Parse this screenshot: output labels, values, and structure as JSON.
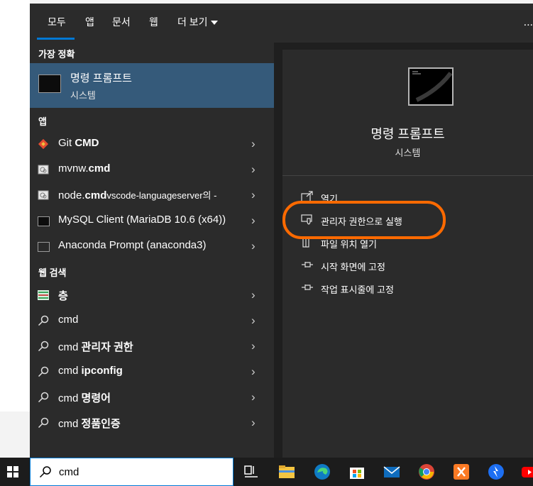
{
  "tabs": {
    "all": "모두",
    "apps": "앱",
    "documents": "문서",
    "web": "웹",
    "more": "더 보기",
    "dots": "..."
  },
  "best_match": {
    "header": "가장 정확",
    "title": "명령 프롬프트",
    "subtitle": "시스템"
  },
  "apps_section": {
    "header": "앱",
    "items": [
      {
        "pre": "Git ",
        "bold": "CMD",
        "post": ""
      },
      {
        "pre": "mvnw.",
        "bold": "cmd",
        "post": ""
      },
      {
        "pre": "node.",
        "bold": "cmd",
        "post": "vscode-languageserver의 -"
      },
      {
        "label": "MySQL Client (MariaDB 10.6 (x64))"
      },
      {
        "label": "Anaconda Prompt (anaconda3)"
      }
    ]
  },
  "web_section": {
    "header": "웹 검색",
    "items": [
      {
        "pre": "",
        "bold": "층",
        "post": ""
      },
      {
        "pre": "cmd",
        "bold": "",
        "post": ""
      },
      {
        "pre": "cmd ",
        "bold": "관리자 권한",
        "post": ""
      },
      {
        "pre": "cmd ",
        "bold": "ipconfig",
        "post": ""
      },
      {
        "pre": "cmd ",
        "bold": "명령어",
        "post": ""
      },
      {
        "pre": "cmd ",
        "bold": "정품인증",
        "post": ""
      }
    ]
  },
  "preview": {
    "title": "명령 프롬프트",
    "subtitle": "시스템",
    "actions": {
      "open": "열기",
      "run_as_admin": "관리자 권한으로 실행",
      "open_location": "파일 위치 열기",
      "pin_start": "시작 화면에 고정",
      "pin_taskbar": "작업 표시줄에 고정"
    }
  },
  "search": {
    "value": "cmd"
  },
  "colors": {
    "accent": "#0078d4",
    "selected": "#355a7a",
    "annotation": "#ff6a00"
  }
}
